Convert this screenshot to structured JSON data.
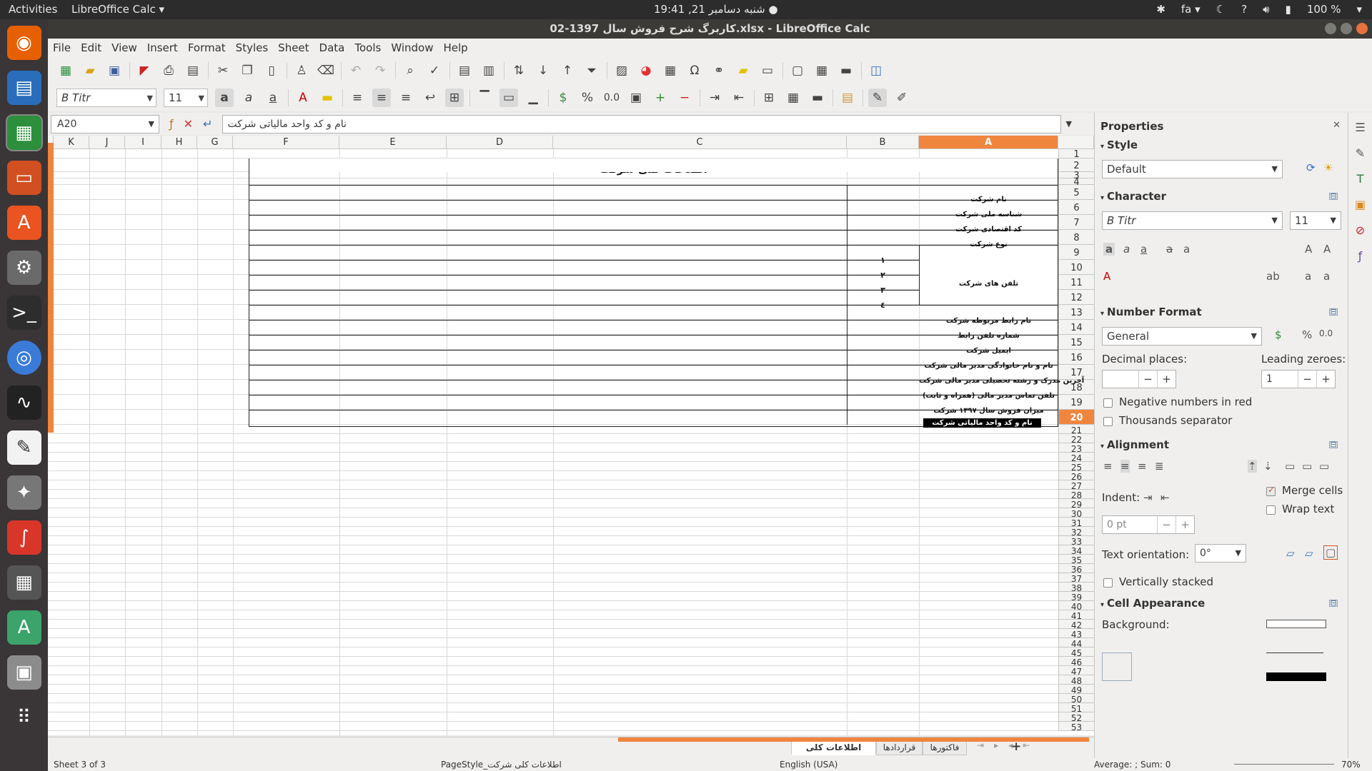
{
  "topbar": {
    "activities": "Activities",
    "app_menu": "LibreOffice Calc ▾",
    "clock": "شنبه دسامبر 21, 19:41 ●",
    "lang": "fa ▾",
    "battery": "100 %"
  },
  "window": {
    "title": "کاربرگ شرح فروش سال 1397-02.xlsx - LibreOffice Calc"
  },
  "menubar": {
    "items": [
      "File",
      "Edit",
      "View",
      "Insert",
      "Format",
      "Styles",
      "Sheet",
      "Data",
      "Tools",
      "Window",
      "Help"
    ]
  },
  "toolbar": {
    "font_name": "B Titr",
    "font_size": "11",
    "percent_label": "%",
    "decimal_label": "0.0"
  },
  "formula_bar": {
    "cell_ref": "A20",
    "content": "نام و کد واحد مالیاتی شرکت"
  },
  "columns": [
    "K",
    "J",
    "I",
    "H",
    "G",
    "F",
    "E",
    "D",
    "C",
    "B",
    "A"
  ],
  "rows": [
    "1",
    "2",
    "3",
    "4",
    "5",
    "6",
    "7",
    "8",
    "9",
    "10",
    "11",
    "12",
    "13",
    "14",
    "15",
    "16",
    "17",
    "18",
    "19",
    "20",
    "21",
    "22",
    "23",
    "24",
    "25",
    "26",
    "27",
    "28",
    "29",
    "30",
    "31",
    "32",
    "33",
    "34",
    "35",
    "36",
    "37",
    "38",
    "39",
    "40",
    "41",
    "42",
    "43",
    "44",
    "45",
    "46",
    "47",
    "48",
    "49",
    "50",
    "51",
    "52",
    "53"
  ],
  "sheet": {
    "title": "اطلاعات کلی شرکت",
    "labels": [
      "نام شرکت",
      "شناسه ملی شرکت",
      "کد اقتصادی شرکت",
      "نوع شرکت",
      "تلفن های شرکت",
      "نام رابط مربوطه  شرکت",
      "شماره تلفن رابط",
      "ایمیل شرکت",
      "نام و نام خانوادگی مدیر مالی شرکت",
      "آخرین مدرک و رشته تحصیلی مدیر مالی شرکت",
      "تلفن تماس مدیر مالی (همراه و ثابت)",
      "میزان فروش سال ۱۳۹۷ شرکت",
      "نام و کد واحد مالیاتی شرکت"
    ],
    "phone_numbers": [
      "۱",
      "۲",
      "۳",
      "٤"
    ]
  },
  "sheet_tabs": {
    "active": "اطلاعات کلی شرکت",
    "tab2": "قراردادها",
    "tab3": "فاکتورها"
  },
  "statusbar": {
    "sheet": "Sheet 3 of 3",
    "page_style": "PageStyle_اطلاعات کلی شرکت",
    "language": "English (USA)",
    "summary": "Average: ; Sum: 0",
    "zoom": "70%"
  },
  "sidebar": {
    "title": "Properties",
    "style_head": "Style",
    "style_value": "Default",
    "char_head": "Character",
    "char_font": "B Titr",
    "char_size": "11",
    "numfmt_head": "Number Format",
    "numfmt_value": "General",
    "decimal_label": "Decimal places:",
    "leading_label": "Leading zeroes:",
    "leading_value": "1",
    "neg_red": "Negative numbers in red",
    "thousands": "Thousands separator",
    "align_head": "Alignment",
    "merge": "Merge cells",
    "wrap": "Wrap text",
    "indent_label": "Indent:",
    "indent_value": "0 pt",
    "orient_label": "Text orientation:",
    "orient_value": "0°",
    "vstacked": "Vertically stacked",
    "cell_head": "Cell Appearance",
    "bg_label": "Background:"
  }
}
